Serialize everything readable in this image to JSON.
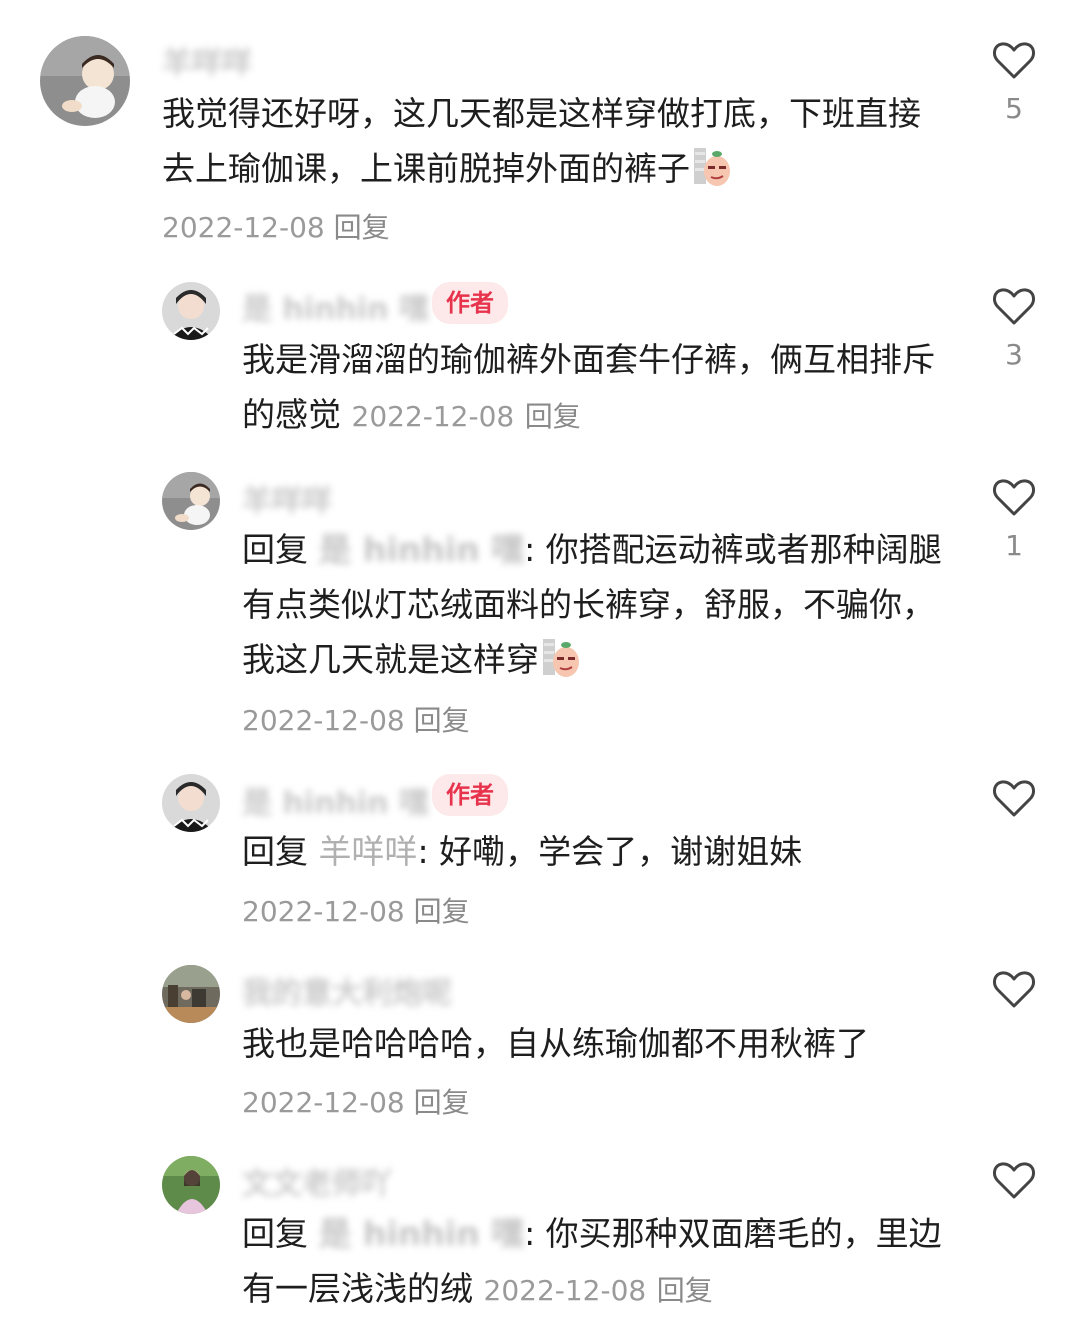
{
  "comments": [
    {
      "username": "羊咩咩",
      "text": "我觉得还好呀，这几天都是这样穿做打底，下班直接去上瑜伽课，上课前脱掉外面的裤子",
      "date": "2022-12-08",
      "reply_label": "回复",
      "likes": "5"
    },
    {
      "username": "是 hinhin 嘿",
      "badge": "作者",
      "text": "我是滑溜溜的瑜伽裤外面套牛仔裤，俩互相排斥的感觉",
      "date": "2022-12-08",
      "reply_label": "回复",
      "likes": "3"
    },
    {
      "username": "羊咩咩",
      "reply_prefix": "回复",
      "reply_to": "是 hinhin 嘿",
      "text": ": 你搭配运动裤或者那种阔腿有点类似灯芯绒面料的长裤穿，舒服，不骗你，我这几天就是这样穿",
      "date": "2022-12-08",
      "reply_label": "回复",
      "likes": "1"
    },
    {
      "username": "是 hinhin 嘿",
      "badge": "作者",
      "reply_prefix": "回复",
      "reply_to": "羊咩咩",
      "text": ": 好嘞，学会了，谢谢姐妹",
      "date": "2022-12-08",
      "reply_label": "回复"
    },
    {
      "username": "我的意大利炮呢",
      "text": "我也是哈哈哈哈，自从练瑜伽都不用秋裤了",
      "date": "2022-12-08",
      "reply_label": "回复"
    },
    {
      "username": "文文老师吖",
      "reply_prefix": "回复",
      "reply_to": "是 hinhin 嘿",
      "text": ": 你买那种双面磨毛的，里边有一层浅浅的绒",
      "date": "2022-12-08",
      "reply_label": "回复"
    }
  ],
  "icons": {
    "like": "heart-outline-icon",
    "emoji": "smirk-emoji-icon"
  }
}
